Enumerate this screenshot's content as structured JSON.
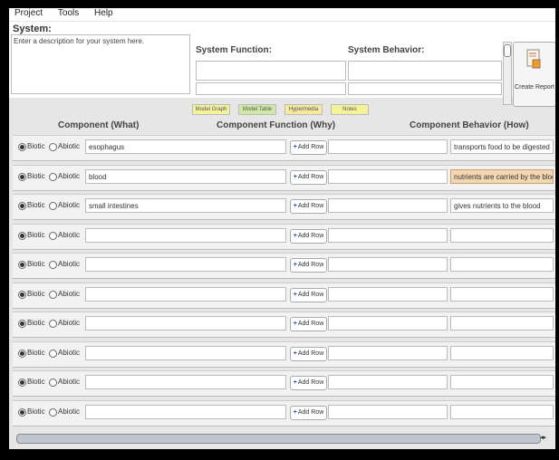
{
  "menu": [
    "Project",
    "Tools",
    "Help"
  ],
  "system": {
    "title": "System:",
    "description_placeholder": "Enter a description for your system here.",
    "function_label": "System Function:",
    "behavior_label": "System Behavior:"
  },
  "report": {
    "label": "Create Report"
  },
  "tabs": [
    {
      "label": "Model Graph",
      "color": "#f5f39a"
    },
    {
      "label": "Model Table",
      "color": "#cfe8a8"
    },
    {
      "label": "Hypermedia",
      "color": "#f7e9a0"
    },
    {
      "label": "Notes",
      "color": "#f5f39a"
    }
  ],
  "columns": {
    "what": "Component (What)",
    "why": "Component Function (Why)",
    "how": "Component Behavior (How)"
  },
  "radio_labels": {
    "biotic": "Biotic",
    "abiotic": "Abiotic"
  },
  "add_row_label": "Add Row",
  "rows": [
    {
      "component": "esophagus",
      "function": "",
      "behavior": "transports food to be digested",
      "highlight": false
    },
    {
      "component": "blood",
      "function": "",
      "behavior": "nutrients are carried by the blood",
      "highlight": true
    },
    {
      "component": "small intestines",
      "function": "",
      "behavior": "gives nutrients to the blood",
      "highlight": false
    },
    {
      "component": "",
      "function": "",
      "behavior": "",
      "highlight": false
    },
    {
      "component": "",
      "function": "",
      "behavior": "",
      "highlight": false
    },
    {
      "component": "",
      "function": "",
      "behavior": "",
      "highlight": false
    },
    {
      "component": "",
      "function": "",
      "behavior": "",
      "highlight": false
    },
    {
      "component": "",
      "function": "",
      "behavior": "",
      "highlight": false
    },
    {
      "component": "",
      "function": "",
      "behavior": "",
      "highlight": false
    },
    {
      "component": "",
      "function": "",
      "behavior": "",
      "highlight": false
    }
  ],
  "highlight_color": "#f4d6b0"
}
